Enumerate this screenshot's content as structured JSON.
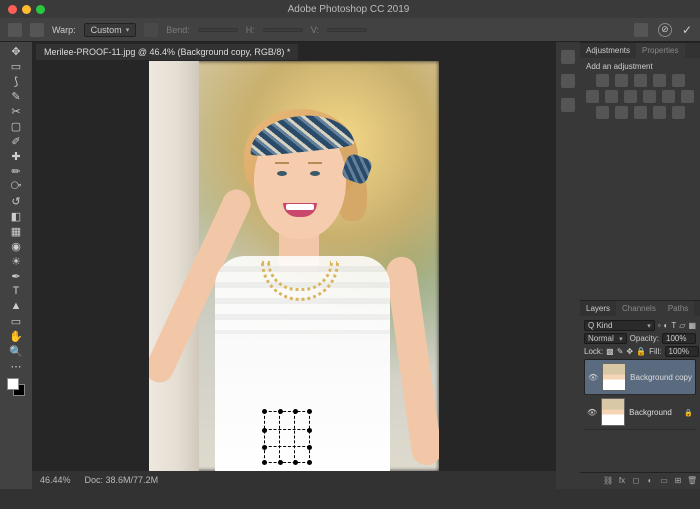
{
  "app": {
    "title": "Adobe Photoshop CC 2019"
  },
  "traffic": {
    "close": "#ff5f57",
    "min": "#febc2e",
    "max": "#28c840"
  },
  "options": {
    "warp_label": "Warp:",
    "warp_value": "Custom",
    "bend_label": "Bend:",
    "h_label": "H:",
    "v_label": "V:",
    "cancel_symbol": "⊘",
    "commit_symbol": "✓"
  },
  "document": {
    "tab_title": "Merilee-PROOF-11.jpg @ 46.4% (Background copy, RGB/8) *",
    "status_zoom": "46.44%",
    "status_doc": "Doc: 38.6M/77.2M"
  },
  "adjustments": {
    "tab1": "Adjustments",
    "tab2": "Properties",
    "hint": "Add an adjustment"
  },
  "layers": {
    "tab1": "Layers",
    "tab2": "Channels",
    "tab3": "Paths",
    "kind_label": "Q Kind",
    "blend_mode": "Normal",
    "opacity_label": "Opacity:",
    "opacity_value": "100%",
    "lock_label": "Lock:",
    "fill_label": "Fill:",
    "fill_value": "100%",
    "items": [
      {
        "name": "Background copy",
        "visible": true,
        "locked": false,
        "selected": true
      },
      {
        "name": "Background",
        "visible": true,
        "locked": true,
        "selected": false
      }
    ]
  }
}
